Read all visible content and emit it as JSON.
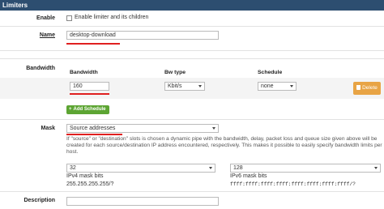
{
  "header": {
    "title": "Limiters"
  },
  "enable": {
    "label": "Enable",
    "checkbox_label": "Enable limiter and its children",
    "checked": false
  },
  "name": {
    "label": "Name",
    "value": "desktop-download"
  },
  "bandwidth": {
    "label": "Bandwidth",
    "columns": {
      "bandwidth": "Bandwidth",
      "bw_type": "Bw type",
      "schedule": "Schedule"
    },
    "value": "160",
    "bw_type": "Kbit/s",
    "schedule": "none",
    "delete_label": "Delete",
    "add_schedule_label": "Add Schedule"
  },
  "mask": {
    "label": "Mask",
    "value": "Source addresses",
    "help": "If \"source\" or \"destination\" slots is chosen a dynamic pipe with the bandwidth, delay, packet loss and queue size given above will be created for each source/destination IP address encountered, respectively. This makes it possible to easily specify bandwidth limits per host.",
    "ipv4_bits": "32",
    "ipv4_label": "IPv4 mask bits",
    "ipv4_mask": "255.255.255.255/?",
    "ipv6_bits": "128",
    "ipv6_label": "IPv6 mask bits",
    "ipv6_mask": "ffff:ffff:ffff:ffff:ffff:ffff:ffff:ffff/?"
  },
  "description": {
    "label": "Description",
    "value": ""
  },
  "colors": {
    "header_bg": "#2d4e70",
    "add_button": "#5da533",
    "delete_button": "#e8a445",
    "underline": "#e02020"
  },
  "icons": {
    "add": "plus-icon",
    "delete": "trash-icon"
  }
}
